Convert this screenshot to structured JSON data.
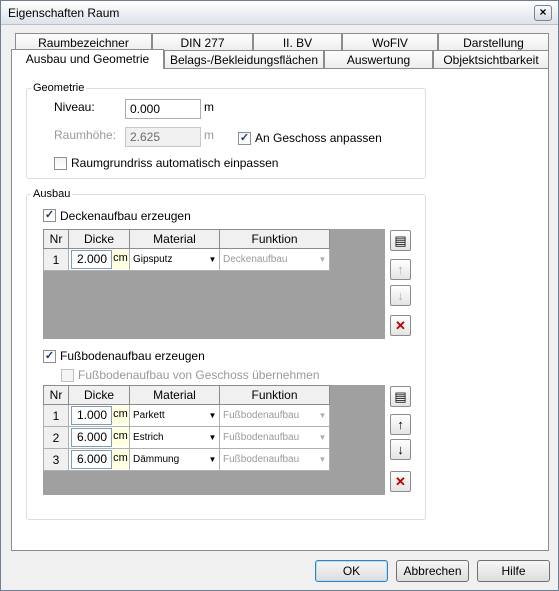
{
  "window": {
    "title": "Eigenschaften Raum",
    "close_glyph": "×"
  },
  "tabs_back": [
    "Raumbezeichner",
    "DIN 277",
    "II. BV",
    "WoFlV",
    "Darstellung"
  ],
  "tabs_front": [
    "Ausbau und Geometrie",
    "Belags-/Bekleidungsflächen",
    "Auswertung",
    "Objektsichtbarkeit"
  ],
  "active_tab": "Ausbau und Geometrie",
  "geometrie": {
    "legend": "Geometrie",
    "niveau_label": "Niveau:",
    "niveau_value": "0.000",
    "niveau_unit": "m",
    "raumhoehe_label": "Raumhöhe:",
    "raumhoehe_value": "2.625",
    "raumhoehe_unit": "m",
    "an_geschoss_label": "An Geschoss anpassen",
    "an_geschoss_checked": true,
    "grundriss_label": "Raumgrundriss automatisch einpassen",
    "grundriss_checked": false
  },
  "ausbau": {
    "legend": "Ausbau",
    "columns": [
      "Nr",
      "Dicke",
      "Material",
      "Funktion"
    ],
    "decke": {
      "checkbox_label": "Deckenaufbau erzeugen",
      "checked": true,
      "rows": [
        {
          "nr": "1",
          "dicke": "2.000",
          "unit": "cm",
          "material": "Gipsputz",
          "funktion": "Deckenaufbau"
        }
      ]
    },
    "boden": {
      "checkbox_label": "Fußbodenaufbau erzeugen",
      "checked": true,
      "uebernehmen_label": "Fußbodenaufbau von Geschoss übernehmen",
      "uebernehmen_checked": false,
      "rows": [
        {
          "nr": "1",
          "dicke": "1.000",
          "unit": "cm",
          "material": "Parkett",
          "funktion": "Fußbodenaufbau"
        },
        {
          "nr": "2",
          "dicke": "6.000",
          "unit": "cm",
          "material": "Estrich",
          "funktion": "Fußbodenaufbau"
        },
        {
          "nr": "3",
          "dicke": "6.000",
          "unit": "cm",
          "material": "Dämmung",
          "funktion": "Fußbodenaufbau"
        }
      ]
    }
  },
  "buttons": {
    "ok": "OK",
    "cancel": "Abbrechen",
    "help": "Hilfe"
  },
  "icons": {
    "new": "new-layer-icon",
    "up": "move-up-icon",
    "down": "move-down-icon",
    "delete": "delete-icon"
  },
  "colors": {
    "grid_bg": "#a0a0a0",
    "unit_bg": "#ffffe1",
    "delete_red": "#c00000"
  }
}
